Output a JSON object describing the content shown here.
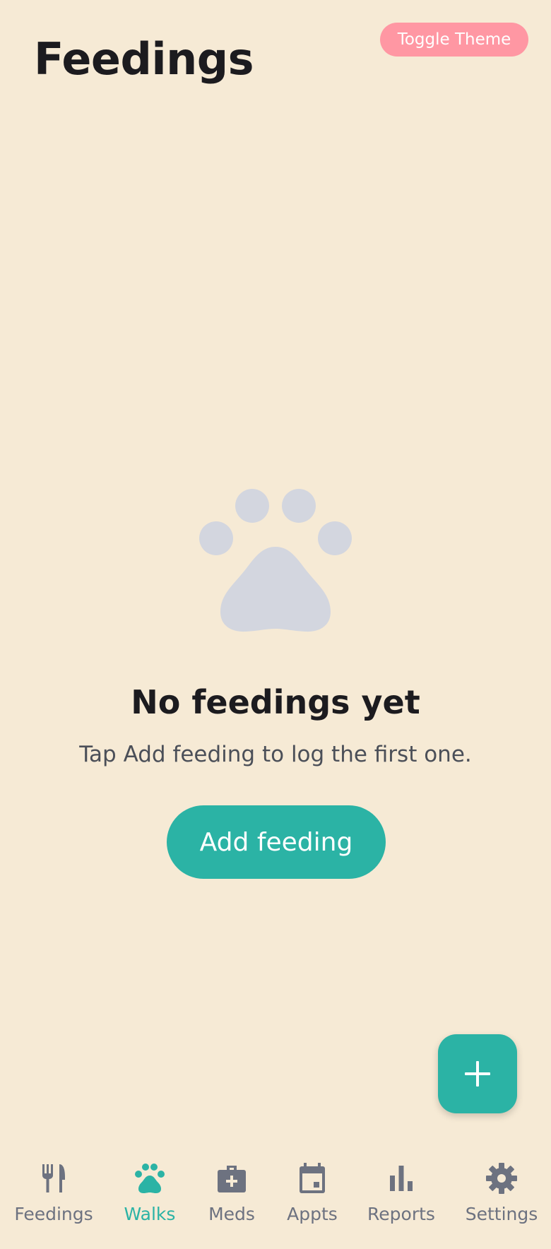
{
  "header": {
    "title": "Feedings",
    "theme_toggle_label": "Toggle Theme"
  },
  "empty_state": {
    "icon": "paw-icon",
    "title": "No feedings yet",
    "subtitle": "Tap Add feeding to log the first one.",
    "button_label": "Add feeding"
  },
  "fab": {
    "icon": "plus-icon"
  },
  "bottom_nav": {
    "items": [
      {
        "label": "Feedings",
        "icon": "fork-knife-icon",
        "active": false
      },
      {
        "label": "Walks",
        "icon": "paw-icon",
        "active": true
      },
      {
        "label": "Meds",
        "icon": "medical-kit-icon",
        "active": false
      },
      {
        "label": "Appts",
        "icon": "calendar-icon",
        "active": false
      },
      {
        "label": "Reports",
        "icon": "bar-chart-icon",
        "active": false
      },
      {
        "label": "Settings",
        "icon": "gear-icon",
        "active": false
      }
    ]
  },
  "colors": {
    "background": "#f6ead5",
    "accent": "#2bb3a5",
    "toggle": "#ff97a3",
    "muted_icon": "#d3d6df",
    "nav_inactive": "#6d7280"
  }
}
